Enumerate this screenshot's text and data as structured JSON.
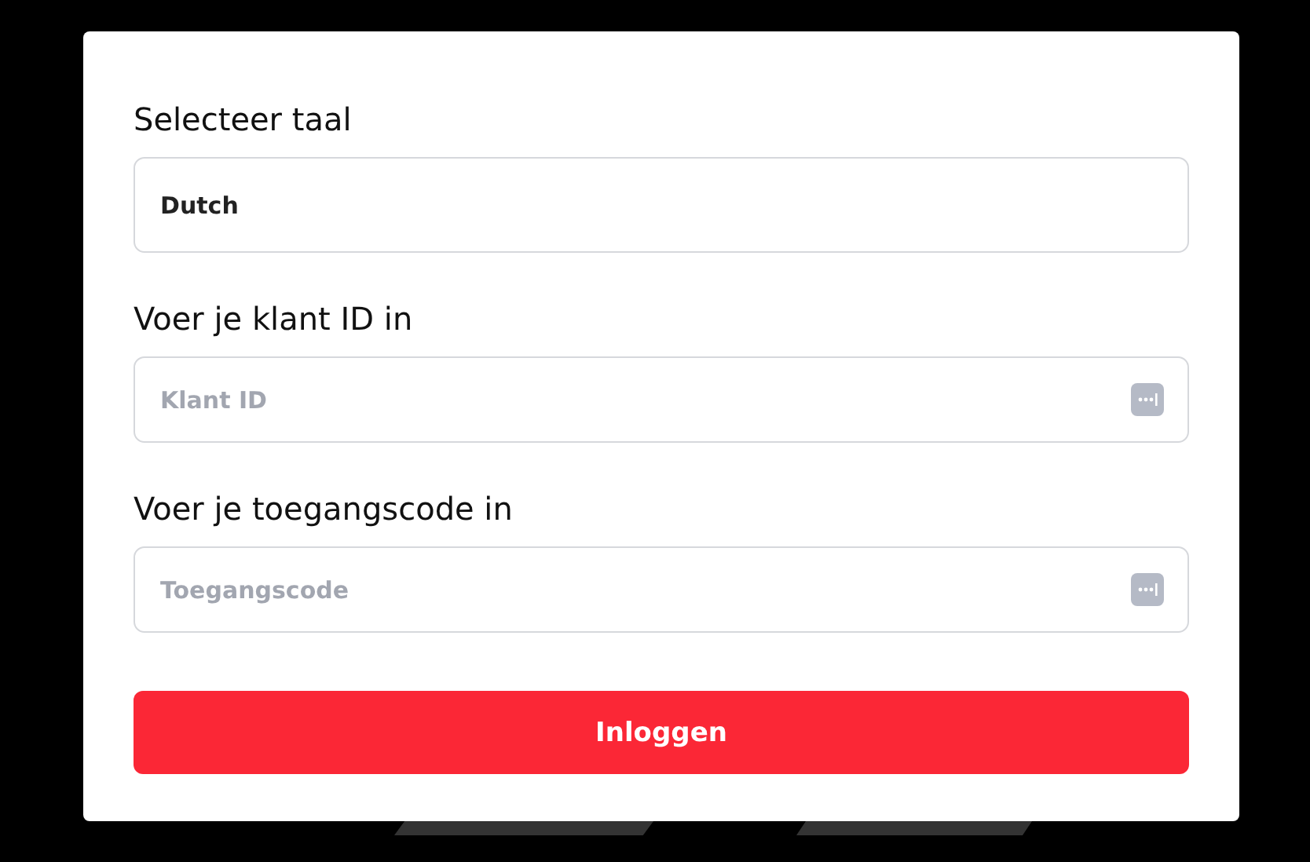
{
  "fields": [
    {
      "kind": "select",
      "label": "Selecteer taal",
      "value": "Dutch"
    },
    {
      "kind": "password",
      "label": "Voer je klant ID in",
      "placeholder": "Klant ID"
    },
    {
      "kind": "password",
      "label": "Voer je toegangscode in",
      "placeholder": "Toegangscode"
    }
  ],
  "submit": {
    "label": "Inloggen"
  }
}
